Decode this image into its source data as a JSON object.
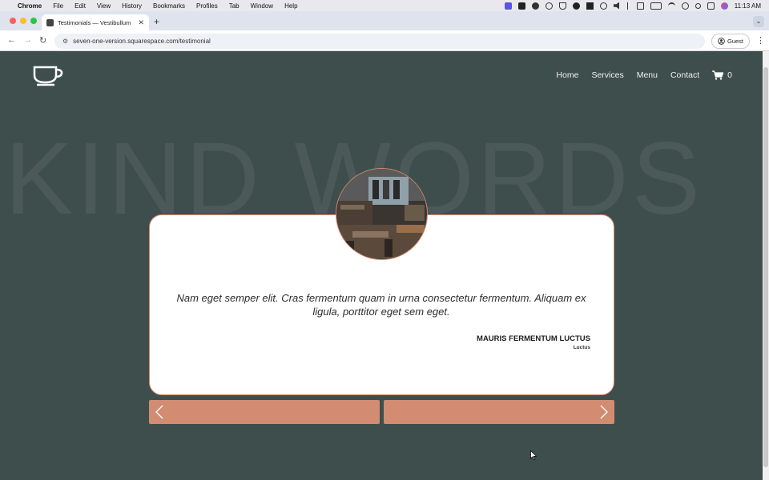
{
  "menubar": {
    "app_name": "Chrome",
    "items": [
      "File",
      "Edit",
      "View",
      "History",
      "Bookmarks",
      "Profiles",
      "Tab",
      "Window",
      "Help"
    ],
    "time": "11:13 AM"
  },
  "browser": {
    "tab_title": "Testimonials — Vestibullum",
    "url": "seven-one-version.squarespace.com/testimonial",
    "profile_label": "Guest"
  },
  "site": {
    "nav": [
      "Home",
      "Services",
      "Menu",
      "Contact"
    ],
    "cart_count": "0",
    "background_word": "KIND WORDS"
  },
  "testimonial": {
    "quote": "Nam eget semper elit. Cras fermentum quam in urna consectetur fermentum. Aliquam ex ligula, porttitor eget sem eget.",
    "author": "MAURIS FERMENTUM LUCTUS",
    "role": "Luctus"
  },
  "colors": {
    "page_bg": "#3e4e4c",
    "accent": "#d18c71",
    "card_bg": "#ffffff"
  },
  "icons": {
    "logo": "coffee-cup-icon",
    "cart": "shopping-cart-icon",
    "prev": "chevron-left-icon",
    "next": "chevron-right-icon"
  }
}
